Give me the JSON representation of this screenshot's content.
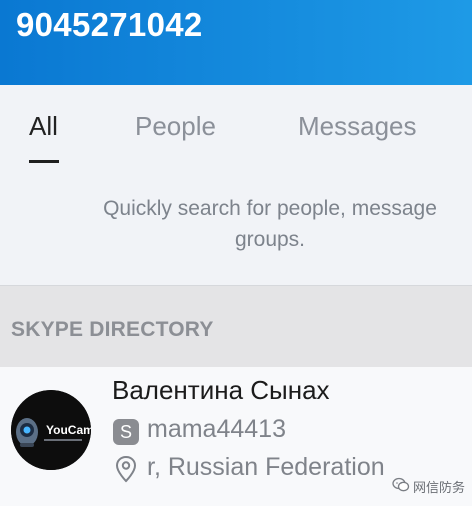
{
  "search": {
    "value": "9045271042"
  },
  "tabs": [
    {
      "label": "All",
      "active": true
    },
    {
      "label": "People",
      "active": false
    },
    {
      "label": "Messages",
      "active": false
    }
  ],
  "hint": "Quickly search for people, messages and groups.",
  "hint_line1": "Quickly search for people, message",
  "hint_line2": "groups.",
  "directory": {
    "title": "SKYPE DIRECTORY"
  },
  "result": {
    "name": "Валентина Сынах",
    "skype_badge": "S",
    "username": "mama44413",
    "location": "r, Russian Federation",
    "avatar": {
      "brand": "YouCam",
      "icon": "webcam-icon"
    }
  },
  "watermark": {
    "text": "网信防务",
    "icon": "wechat-icon"
  },
  "colors": {
    "header_gradient_start": "#0a78d2",
    "header_gradient_end": "#1e9ae6",
    "background": "#f1f3f7",
    "section_bg": "#e4e4e6"
  }
}
